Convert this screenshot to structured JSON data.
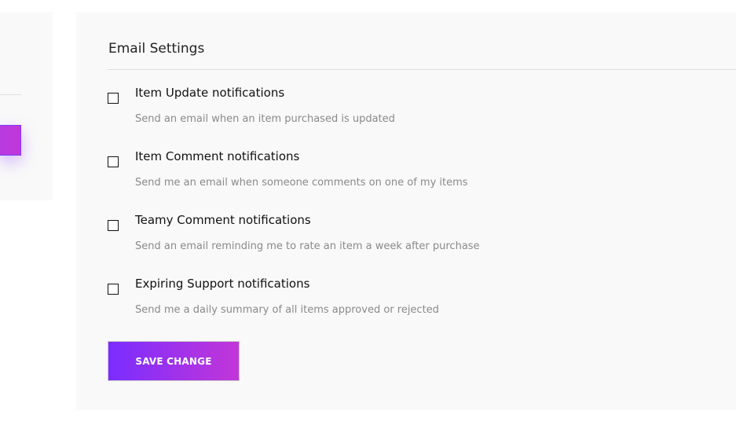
{
  "email_settings": {
    "title": "Email Settings",
    "options": [
      {
        "label": "Item Update notifications",
        "description": "Send an email when an item purchased is updated",
        "checked": false
      },
      {
        "label": "Item Comment notifications",
        "description": "Send me an email when someone comments on one of my items",
        "checked": false
      },
      {
        "label": "Teamy Comment notifications",
        "description": "Send an email reminding me to rate an item a week after purchase",
        "checked": false
      },
      {
        "label": "Expiring Support notifications",
        "description": "Send me a daily summary of all items approved or rejected",
        "checked": false
      }
    ],
    "save_label": "SAVE CHANGE"
  },
  "colors": {
    "gradient_start": "#7a2dff",
    "gradient_end": "#c236d8"
  }
}
